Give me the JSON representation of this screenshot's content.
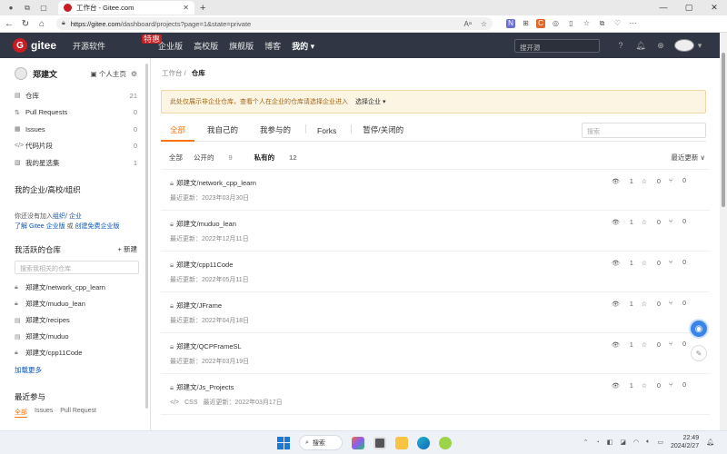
{
  "browser": {
    "tab_title": "工作台 - Gitee.com",
    "url": "https://gitee.com/dashboard/projects?page=1&state=private",
    "url_host": "https://gitee.com",
    "url_path": "/dashboard/projects?page=1&state=private"
  },
  "header": {
    "logo_text": "gitee",
    "nav": [
      "开源软件",
      "企业版",
      "高校版",
      "旗舰版",
      "博客",
      "我的 ▾"
    ],
    "nav_badge": "特惠",
    "search_placeholder": "搜开源"
  },
  "sidebar": {
    "username": "郑建文",
    "home_link": "个人主页",
    "menu": [
      {
        "icon": "repo-icon",
        "label": "仓库",
        "count": "21"
      },
      {
        "icon": "pull-request-icon",
        "label": "Pull Requests",
        "count": "0"
      },
      {
        "icon": "issue-icon",
        "label": "Issues",
        "count": "0"
      },
      {
        "icon": "code-snippet-icon",
        "label": "代码片段",
        "count": "0"
      },
      {
        "icon": "star-icon",
        "label": "我的星选集",
        "count": "1"
      }
    ],
    "org_title": "我的企业/高校/组织",
    "org_text_1": "你还没有加入",
    "org_link_1": "组织",
    "org_text_2": "/",
    "org_link_2": "企业",
    "org_text_3": "了解 Gitee 企业版",
    "org_text_4": "或",
    "org_link_3": "创建免费企业版",
    "active_repos_title": "我活跃的仓库",
    "new_label": "+ 新建",
    "repo_search_placeholder": "搜索我相关的仓库",
    "active_repos": [
      {
        "icon": "lock-icon",
        "name": "郑建文/network_cpp_learn"
      },
      {
        "icon": "lock-icon",
        "name": "郑建文/muduo_lean"
      },
      {
        "icon": "repo-icon",
        "name": "郑建文/recipes"
      },
      {
        "icon": "repo-icon",
        "name": "郑建文/muduo"
      },
      {
        "icon": "lock-icon",
        "name": "郑建文/cpp11Code"
      }
    ],
    "load_more": "加载更多",
    "recent_title": "最近参与",
    "recent_tabs": [
      "全部",
      "Issues",
      "Pull Request"
    ]
  },
  "main": {
    "breadcrumb_root": "工作台",
    "breadcrumb_sep": "/",
    "breadcrumb_current": "仓库",
    "notice": "此处仅展示非企业仓库，查看个人在企业的仓库请选择企业进入",
    "notice_select": "选择企业 ▾",
    "tabs": [
      "全部",
      "我自己的",
      "我参与的",
      "Forks",
      "暂停/关闭的"
    ],
    "search_placeholder": "搜索",
    "filter_all": "全部",
    "filter_public": "公开的",
    "filter_public_count": "9",
    "filter_private": "私有的",
    "filter_private_count": "12",
    "sort_label": "最近更新 ∨",
    "repos": [
      {
        "name": "郑建文/network_cpp_learn",
        "lang": "",
        "updated": "最近更新：2023年03月30日",
        "watch": "1",
        "star": "0",
        "fork": "0"
      },
      {
        "name": "郑建文/muduo_lean",
        "lang": "",
        "updated": "最近更新：2022年12月11日",
        "watch": "1",
        "star": "0",
        "fork": "0"
      },
      {
        "name": "郑建文/cpp11Code",
        "lang": "",
        "updated": "最近更新：2022年05月11日",
        "watch": "1",
        "star": "0",
        "fork": "0"
      },
      {
        "name": "郑建文/JFrame",
        "lang": "",
        "updated": "最近更新：2022年04月18日",
        "watch": "1",
        "star": "0",
        "fork": "0"
      },
      {
        "name": "郑建文/QCPFrameSL",
        "lang": "",
        "updated": "最近更新：2022年03月19日",
        "watch": "1",
        "star": "0",
        "fork": "0"
      },
      {
        "name": "郑建文/Js_Projects",
        "lang": "CSS",
        "updated": "最近更新：2022年03月17日",
        "watch": "1",
        "star": "0",
        "fork": "0"
      }
    ]
  },
  "taskbar": {
    "search_label": "搜索",
    "time": "22:49",
    "date": "2024/2/27"
  }
}
